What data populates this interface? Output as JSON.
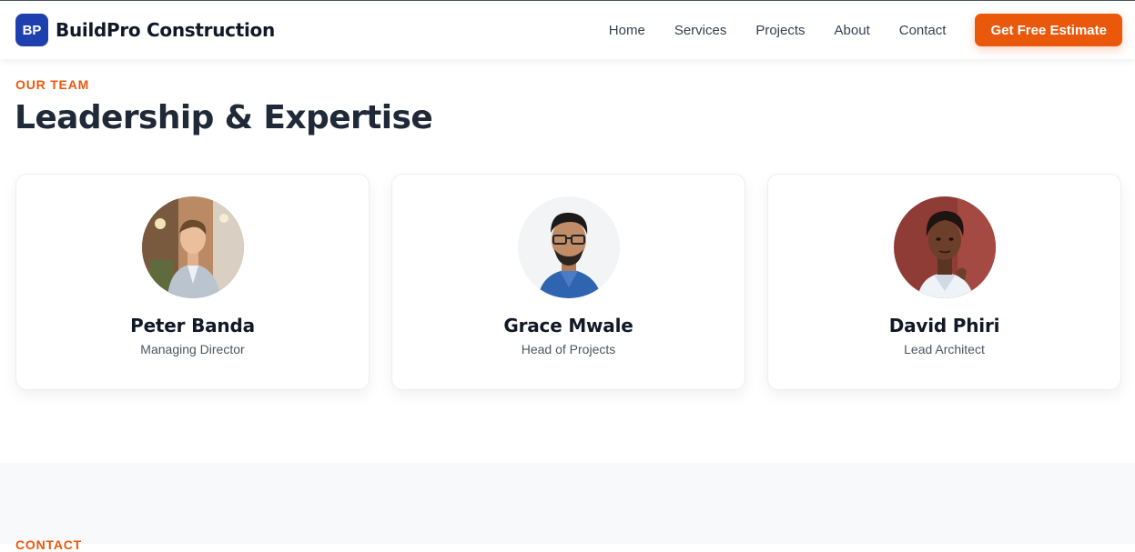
{
  "brand": {
    "logo_text": "BP",
    "name": "BuildPro Construction",
    "accent_color": "#1e40af"
  },
  "nav": {
    "links": [
      "Home",
      "Services",
      "Projects",
      "About",
      "Contact"
    ],
    "cta_label": "Get Free Estimate",
    "cta_color": "#ea580c"
  },
  "team": {
    "eyebrow": "OUR TEAM",
    "title": "Leadership & Expertise",
    "members": [
      {
        "name": "Peter Banda",
        "role": "Managing Director",
        "avatar_icon": "person-photo"
      },
      {
        "name": "Grace Mwale",
        "role": "Head of Projects",
        "avatar_icon": "person-photo"
      },
      {
        "name": "David Phiri",
        "role": "Lead Architect",
        "avatar_icon": "person-photo"
      }
    ]
  },
  "contact": {
    "eyebrow": "CONTACT"
  }
}
